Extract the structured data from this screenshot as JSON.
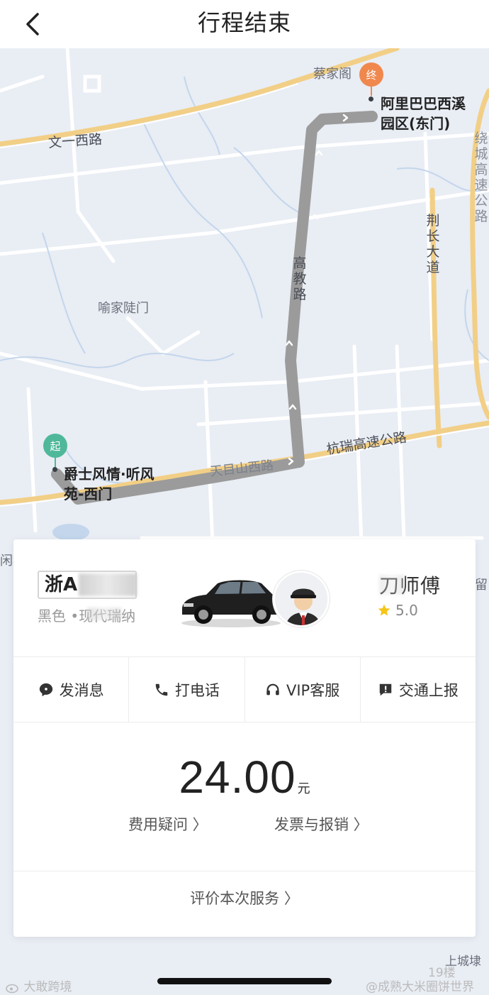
{
  "header": {
    "title": "行程结束"
  },
  "map": {
    "start_pin": "起",
    "end_pin": "终",
    "start_poi": [
      "爵士风情·听风",
      "苑-西门"
    ],
    "end_poi": [
      "阿里巴巴西溪",
      "园区(东门)"
    ],
    "labels": {
      "caijiage": "蔡家阁",
      "wenyi_west": "文一西路",
      "yujia": "喻家陡门",
      "tianmushan": "天目山西路",
      "hangrui": "杭瑞高速公路",
      "gaojiao": "高教路",
      "jingchang": "荆长大道",
      "highway_right": "绕城高速公路",
      "left_edge": "闲林",
      "shangcheng": "上城埭",
      "liu": "留"
    }
  },
  "driver": {
    "plate": "浙A",
    "car_desc": "黑色 •现代瑞纳",
    "name": "刀师傅",
    "rating": "5.0"
  },
  "actions": [
    {
      "label": "发消息",
      "icon": "message-icon"
    },
    {
      "label": "打电话",
      "icon": "phone-icon"
    },
    {
      "label": "VIP客服",
      "icon": "headset-icon"
    },
    {
      "label": "交通上报",
      "icon": "report-icon"
    }
  ],
  "fare": {
    "amount": "24.00",
    "unit": "元",
    "question_link": "费用疑问 〉",
    "invoice_link": "发票与报销 〉"
  },
  "rate_link": "评价本次服务 〉",
  "watermarks": {
    "left": "大敢跨境",
    "right": "@成熟大米圈饼世界",
    "logo": "19楼"
  },
  "colors": {
    "route": "#9b9b9b",
    "highway": "#f2cf86",
    "start": "#4fb89a",
    "end": "#f0884e",
    "star": "#f5c518"
  }
}
